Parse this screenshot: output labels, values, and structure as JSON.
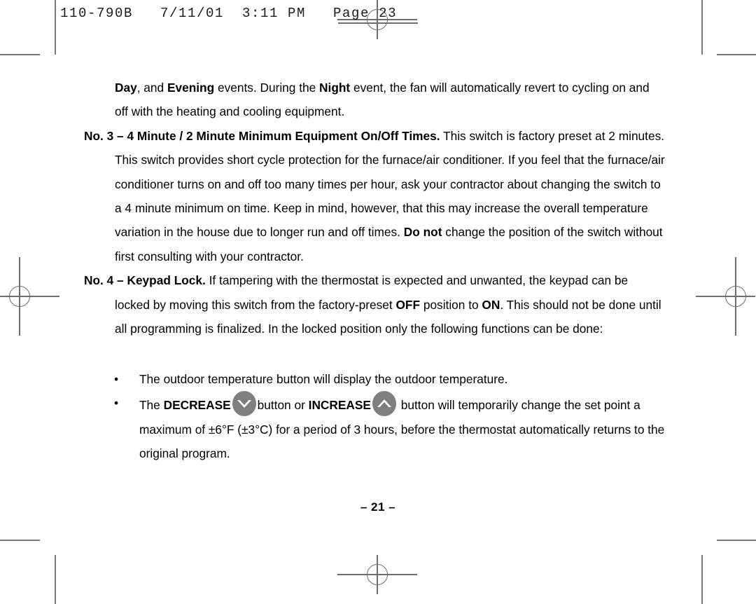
{
  "scan_header": {
    "text": "110-790B   7/11/01  3:11 PM   Page 23"
  },
  "body": {
    "paragraph_1": {
      "run_1_bold": "Day",
      "run_2": ", and ",
      "run_3_bold": "Evening",
      "run_4": " events. During the ",
      "run_5_bold": "Night",
      "run_6": " event, the fan will automatically revert to cycling on and off with the heating and cooling equipment."
    },
    "paragraph_2": {
      "heading_bold": "No. 3 – 4 Minute / 2 Minute Minimum Equipment On/Off Times.",
      "run_1": " This switch is factory preset at 2 minutes. This switch provides short cycle protection for the furnace/air conditioner. If you feel that the furnace/air conditioner turns on and off too many times per hour, ask your contractor about changing the switch to a 4 minute minimum on time. Keep in mind, however, that this may increase the overall temperature variation in the house due to longer run and off times. ",
      "run_2_bold": "Do not",
      "run_3": " change the position of the switch without first consulting with your contractor."
    },
    "paragraph_3": {
      "heading_bold": "No. 4 – Keypad Lock.",
      "run_1": " If tampering with the thermostat is expected and unwanted, the keypad can be locked by moving this switch from the factory-preset ",
      "run_2_bold": "OFF",
      "run_3": " position to ",
      "run_4_bold": "ON",
      "run_5": ". This should not be done until all programming is finalized. In the locked position only the following functions can be done:"
    }
  },
  "bullets": {
    "marker": "•",
    "item_1": {
      "text": "The outdoor temperature button will display the outdoor temperature."
    },
    "item_2": {
      "run_1": "The ",
      "run_2_bold": "DECREASE",
      "decrease_icon_name": "decrease-arrow-button-icon",
      "run_3": "button or ",
      "run_4_bold": "INCREASE",
      "increase_icon_name": "increase-arrow-button-icon",
      "run_5": " button will temporarily change the set point a maximum of ±6°F (±3°C) for a period of 3 hours, before the thermostat automatically returns to the original program."
    }
  },
  "footer": {
    "folio": "– 21 –"
  },
  "colors": {
    "page_background": "#ffffff",
    "text": "#000000",
    "button_disc": "#7f7f7f",
    "button_glyph": "#ffffff",
    "trim_mark": "#7a7a7a",
    "registration_mark": "#6e6e6e"
  }
}
